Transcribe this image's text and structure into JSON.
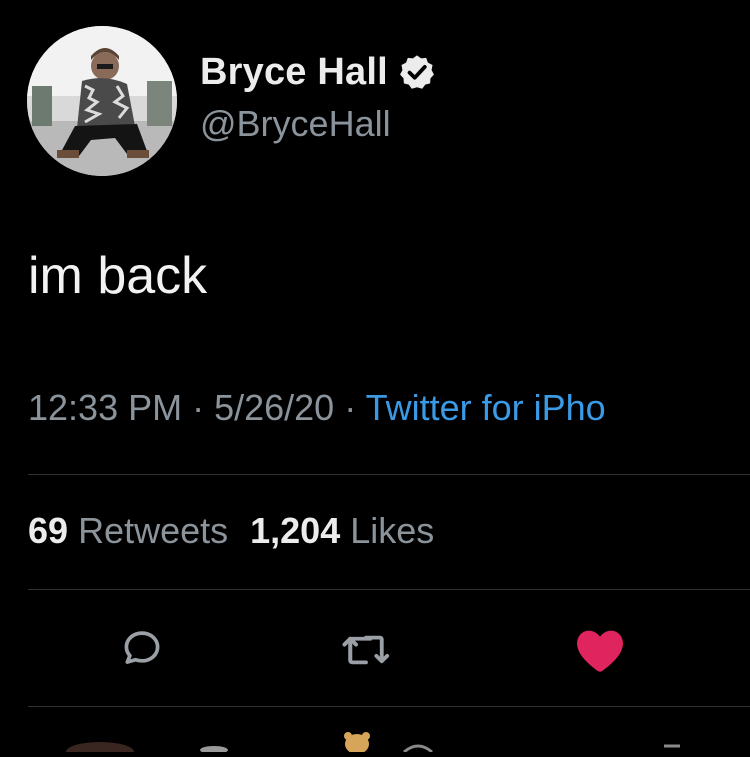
{
  "user": {
    "display_name": "Bryce Hall",
    "handle": "@BryceHall",
    "verified": true
  },
  "tweet": {
    "text": "im back",
    "time": "12:33 PM",
    "date": "5/26/20",
    "source": "Twitter for iPho",
    "separator": " · "
  },
  "stats": {
    "retweets_count": "69",
    "retweets_label": "Retweets",
    "likes_count": "1,204",
    "likes_label": "Likes"
  },
  "actions": {
    "reply_icon": "reply-icon",
    "retweet_icon": "retweet-icon",
    "like_icon": "heart-icon",
    "liked": true
  },
  "colors": {
    "background": "#000000",
    "link": "#3a9ae6",
    "muted": "#8b939b",
    "like": "#e0245e"
  }
}
